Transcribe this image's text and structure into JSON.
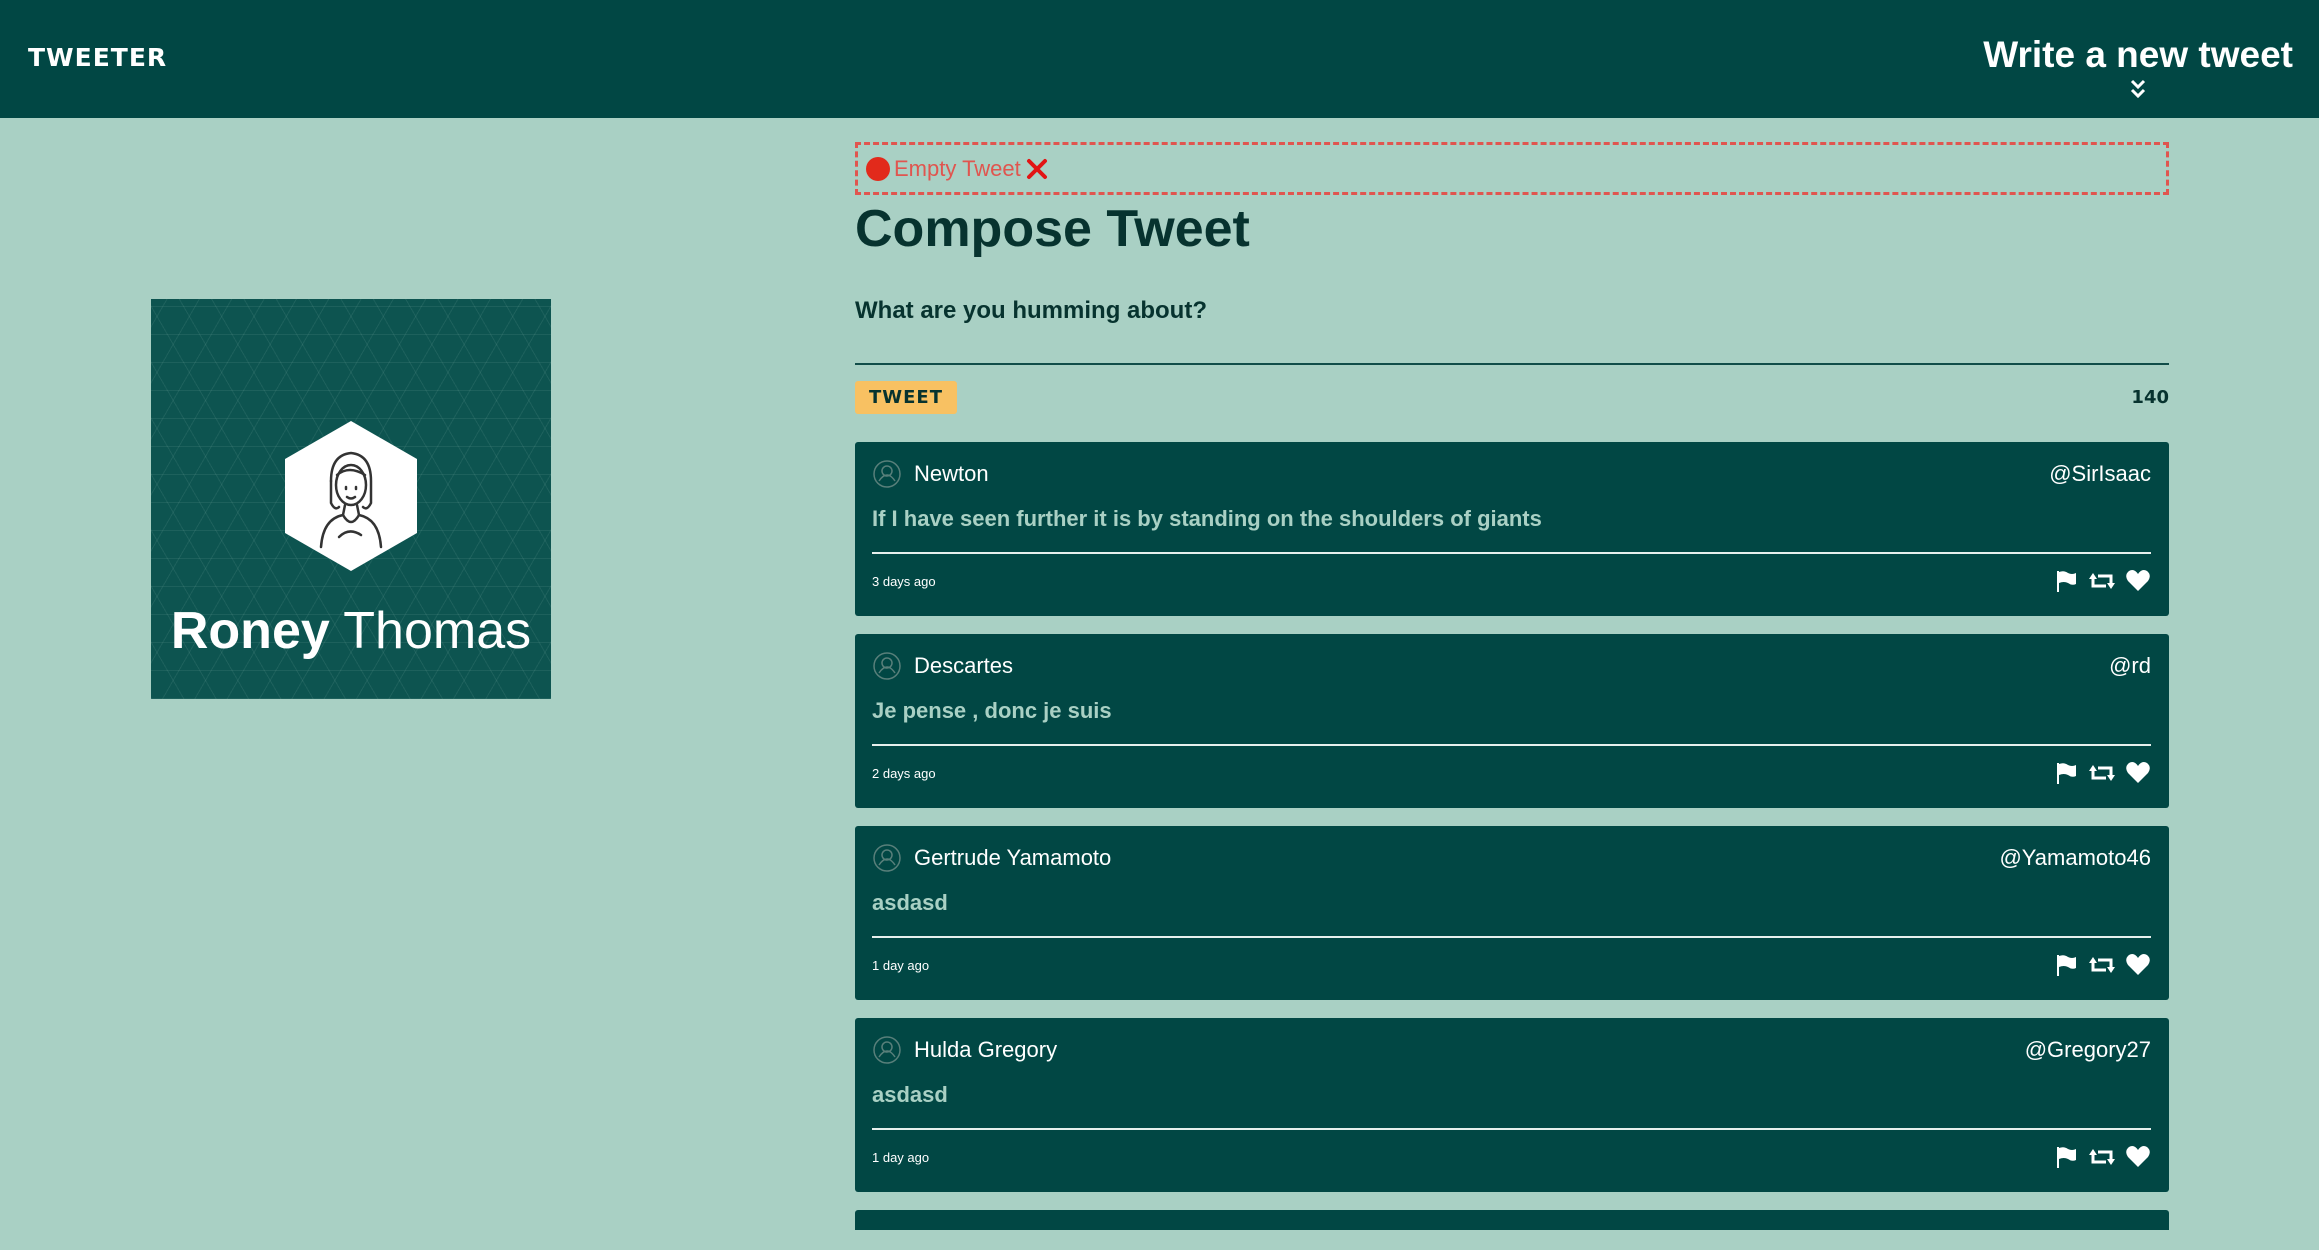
{
  "nav": {
    "brand": "TWEETER",
    "write_label": "Write a new tweet",
    "write_icon": "double-chevron-down-icon"
  },
  "profile": {
    "first_name": "Roney",
    "last_name": "Thomas",
    "avatar_icon": "user-avatar-icon"
  },
  "compose": {
    "error_text": "Empty Tweet",
    "title": "Compose Tweet",
    "placeholder": "What are you humming about?",
    "button_label": "TWEET",
    "counter": "140"
  },
  "tweets": [
    {
      "name": "Newton",
      "handle": "@SirIsaac",
      "text": "If I have seen further it is by standing on the shoulders of giants",
      "time": "3 days ago"
    },
    {
      "name": "Descartes",
      "handle": "@rd",
      "text": "Je pense , donc je suis",
      "time": "2 days ago"
    },
    {
      "name": "Gertrude Yamamoto",
      "handle": "@Yamamoto46",
      "text": "asdasd",
      "time": "1 day ago"
    },
    {
      "name": "Hulda Gregory",
      "handle": "@Gregory27",
      "text": "asdasd",
      "time": "1 day ago"
    }
  ],
  "colors": {
    "background": "#a9d0c4",
    "primary": "#014744",
    "button": "#f8c162",
    "error": "#e0554f"
  },
  "icons": {
    "flag": "flag-icon",
    "retweet": "retweet-icon",
    "like": "heart-icon"
  }
}
